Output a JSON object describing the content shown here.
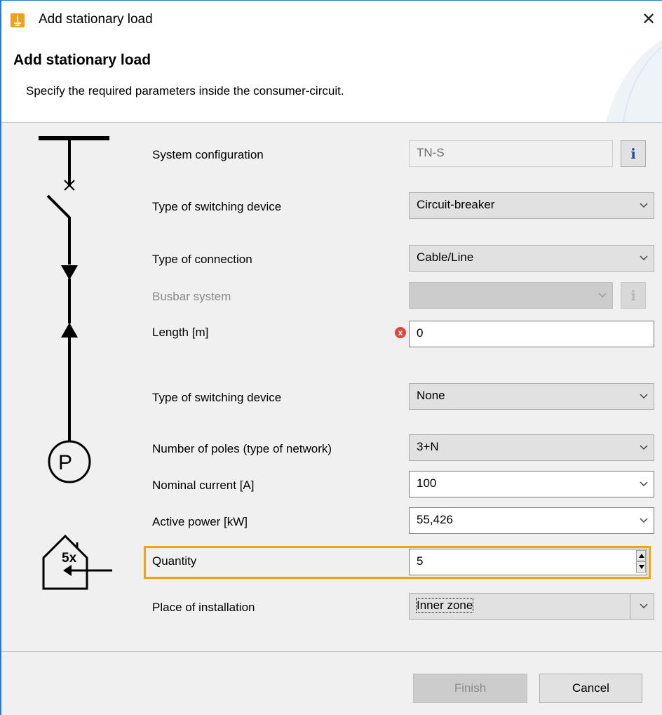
{
  "window": {
    "title": "Add stationary load",
    "close_glyph": "✕"
  },
  "header": {
    "title": "Add stationary load",
    "description": "Specify the required parameters inside the consumer-circuit."
  },
  "diagram": {
    "load_symbol": "P",
    "quantity_label": "5x"
  },
  "form": {
    "system_configuration": {
      "label": "System configuration",
      "value": "TN-S"
    },
    "switching_device_1": {
      "label": "Type of switching device",
      "value": "Circuit-breaker"
    },
    "connection": {
      "label": "Type of connection",
      "value": "Cable/Line"
    },
    "busbar": {
      "label": "Busbar system",
      "value": ""
    },
    "length": {
      "label": "Length [m]",
      "value": "0"
    },
    "switching_device_2": {
      "label": "Type of switching device",
      "value": "None"
    },
    "poles": {
      "label": "Number of poles (type of network)",
      "value": "3+N"
    },
    "nominal_current": {
      "label": "Nominal current [A]",
      "value": "100"
    },
    "active_power": {
      "label": "Active power [kW]",
      "value": "55,426"
    },
    "quantity": {
      "label": "Quantity",
      "value": "5"
    },
    "installation": {
      "label": "Place of installation",
      "value": "Inner zone"
    }
  },
  "icons": {
    "info": "i",
    "error": "x"
  },
  "buttons": {
    "finish": "Finish",
    "cancel": "Cancel"
  },
  "colors": {
    "highlight": "#f5a30a",
    "accent_border": "#2b78c8",
    "error": "#d9473e",
    "info": "#1a4f9c"
  }
}
